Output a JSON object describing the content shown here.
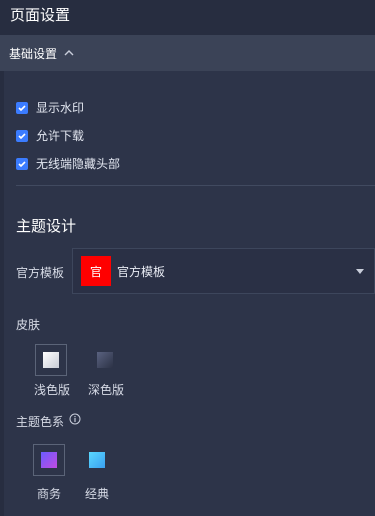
{
  "panel": {
    "title": "页面设置"
  },
  "section": {
    "title": "基础设置"
  },
  "checkboxes": [
    {
      "label": "显示水印",
      "checked": true
    },
    {
      "label": "允许下载",
      "checked": true
    },
    {
      "label": "无线端隐藏头部",
      "checked": true
    }
  ],
  "theme": {
    "title": "主题设计",
    "template_label": "官方模板",
    "template_badge": "官",
    "template_value": "官方模板",
    "skin_label": "皮肤",
    "skins": [
      {
        "label": "浅色版",
        "selected": true
      },
      {
        "label": "深色版",
        "selected": false
      }
    ],
    "color_label": "主题色系",
    "colors": [
      {
        "label": "商务",
        "selected": true
      },
      {
        "label": "经典",
        "selected": false
      }
    ]
  },
  "colors": {
    "accent": "#3b7cff",
    "badge": "#ff0000",
    "background": "#272d40"
  },
  "icons": [
    "chevron-up-icon",
    "check-icon",
    "caret-down-icon",
    "info-icon"
  ]
}
